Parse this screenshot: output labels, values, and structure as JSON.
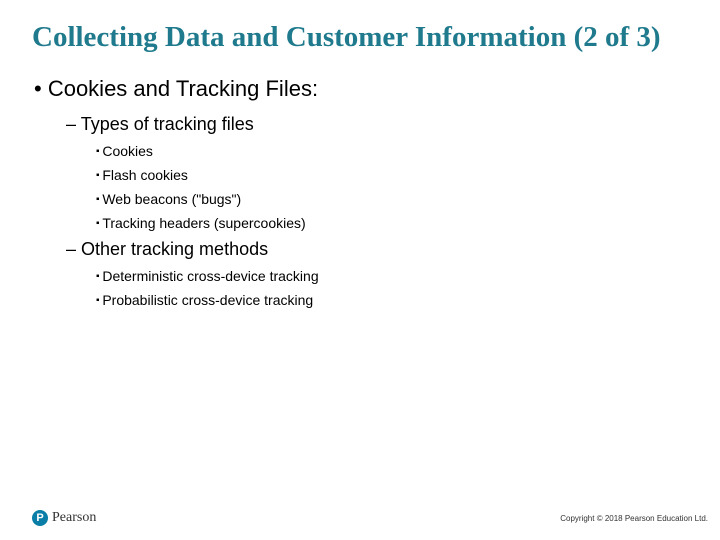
{
  "title": "Collecting Data and Customer Information (2 of 3)",
  "bullets": {
    "top": "Cookies and Tracking Files:",
    "sub1": {
      "heading": "Types of tracking files",
      "items": [
        "Cookies",
        "Flash cookies",
        "Web beacons (\"bugs\")",
        "Tracking headers (supercookies)"
      ]
    },
    "sub2": {
      "heading": "Other tracking methods",
      "items": [
        "Deterministic cross-device tracking",
        "Probabilistic cross-device tracking"
      ]
    }
  },
  "footer": {
    "logo_initial": "P",
    "logo_text": "Pearson",
    "copyright": "Copyright © 2018 Pearson Education Ltd."
  }
}
